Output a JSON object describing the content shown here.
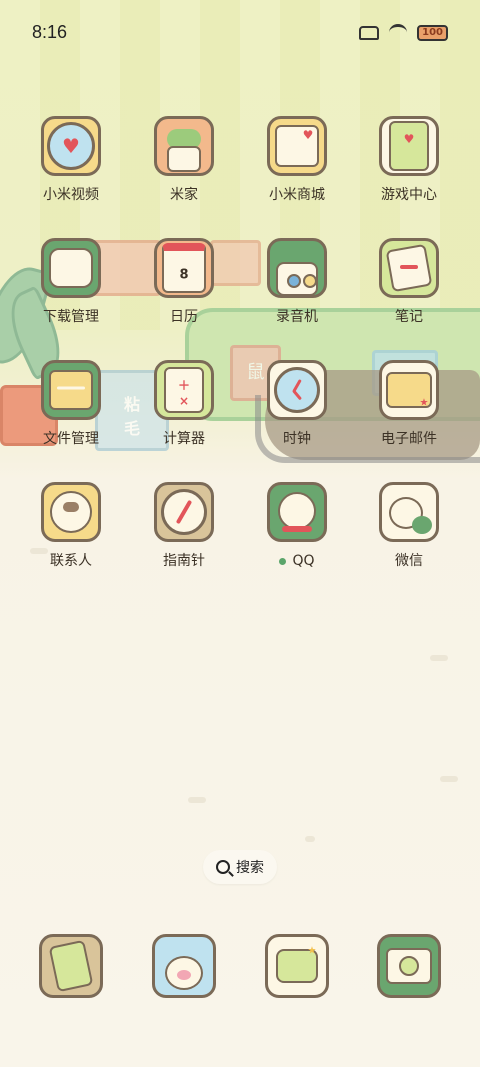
{
  "status_bar": {
    "time": "8:16",
    "battery": "100"
  },
  "apps": [
    {
      "label": "小米视频"
    },
    {
      "label": "米家"
    },
    {
      "label": "小米商城"
    },
    {
      "label": "游戏中心"
    },
    {
      "label": "下载管理"
    },
    {
      "label": "日历",
      "date": "8"
    },
    {
      "label": "录音机"
    },
    {
      "label": "笔记"
    },
    {
      "label": "文件管理"
    },
    {
      "label": "计算器"
    },
    {
      "label": "时钟"
    },
    {
      "label": "电子邮件"
    },
    {
      "label": "联系人"
    },
    {
      "label": "指南针"
    },
    {
      "label": "QQ"
    },
    {
      "label": "微信"
    }
  ],
  "search": {
    "label": "搜索"
  },
  "wallpaper_text": {
    "sign1": "粘",
    "sign2": "毛",
    "sign3": "鼠"
  },
  "colors": {
    "green": "#6aa66f",
    "yellow": "#f6da8a",
    "peach": "#f3b98c",
    "cream": "#fdf7e5",
    "outline": "#7b6a57"
  }
}
